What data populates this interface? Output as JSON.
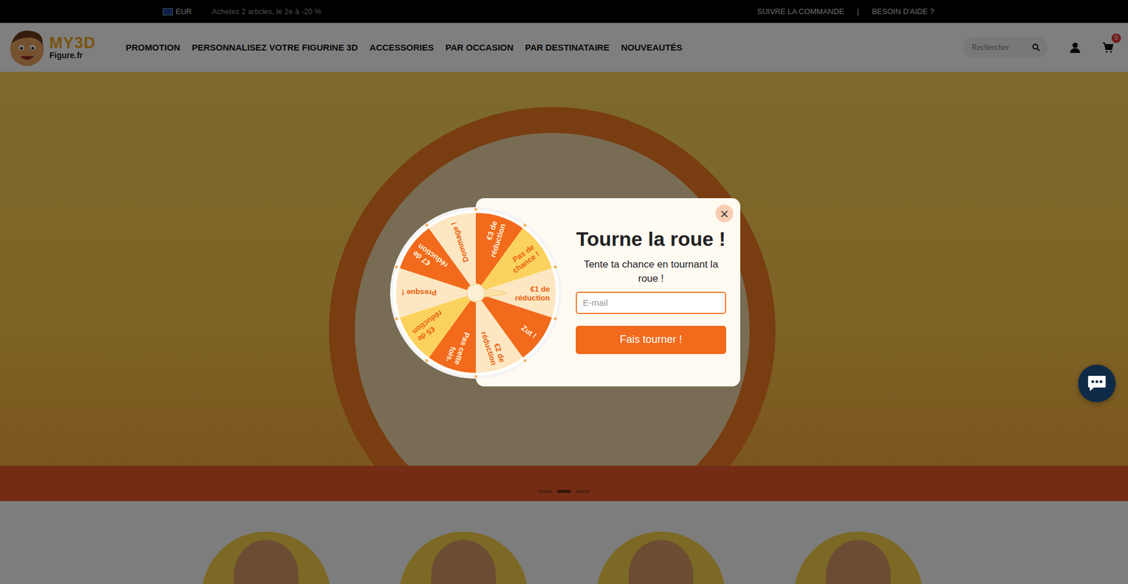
{
  "top_bar": {
    "currency": "EUR",
    "announcement": "Achetez 2 articles, le 2e à -20 %",
    "links": [
      "SUIVRE LA COMMANDE",
      "|",
      "BESOIN D'AIDE ?"
    ]
  },
  "header": {
    "logo": {
      "brand": "MY3D",
      "domain": "Figure.fr"
    },
    "nav": [
      "PROMOTION",
      "PERSONNALISEZ VOTRE FIGURINE 3D",
      "ACCESSORIES",
      "PAR OCCASION",
      "PAR DESTINATAIRE",
      "NOUVEAUTÉS"
    ],
    "search": {
      "placeholder": "Rechercher"
    },
    "cart_count": "0"
  },
  "hero": {
    "dots": [
      {
        "selected": false
      },
      {
        "selected": true
      },
      {
        "selected": false
      }
    ]
  },
  "popup": {
    "close": "×",
    "title": "Tourne la roue !",
    "subtitle": "Tente ta chance en tournant la roue !",
    "email_placeholder": "E-mail",
    "button": "Fais tourner !",
    "wheel": {
      "segments": [
        {
          "lines": [
            "€3 de",
            "réduction"
          ],
          "color": "#f26a1b"
        },
        {
          "lines": [
            "Pas de",
            "chance !"
          ],
          "color": "#fcd25e"
        },
        {
          "lines": [
            "€1 de",
            "réduction"
          ],
          "color": "#fde7c2"
        },
        {
          "lines": [
            "Zut !"
          ],
          "color": "#f26a1b"
        },
        {
          "lines": [
            "€2 de",
            "réduction"
          ],
          "color": "#fde7c2"
        },
        {
          "lines": [
            "Pas cette",
            "fois."
          ],
          "color": "#f26a1b"
        },
        {
          "lines": [
            "€5 de",
            "réduction"
          ],
          "color": "#fcd25e"
        },
        {
          "lines": [
            "Presque !"
          ],
          "color": "#fde7c2"
        },
        {
          "lines": [
            "€7 de",
            "réduction"
          ],
          "color": "#f26a1b"
        },
        {
          "lines": [
            "Dommage !"
          ],
          "color": "#fde7c2"
        }
      ]
    }
  }
}
